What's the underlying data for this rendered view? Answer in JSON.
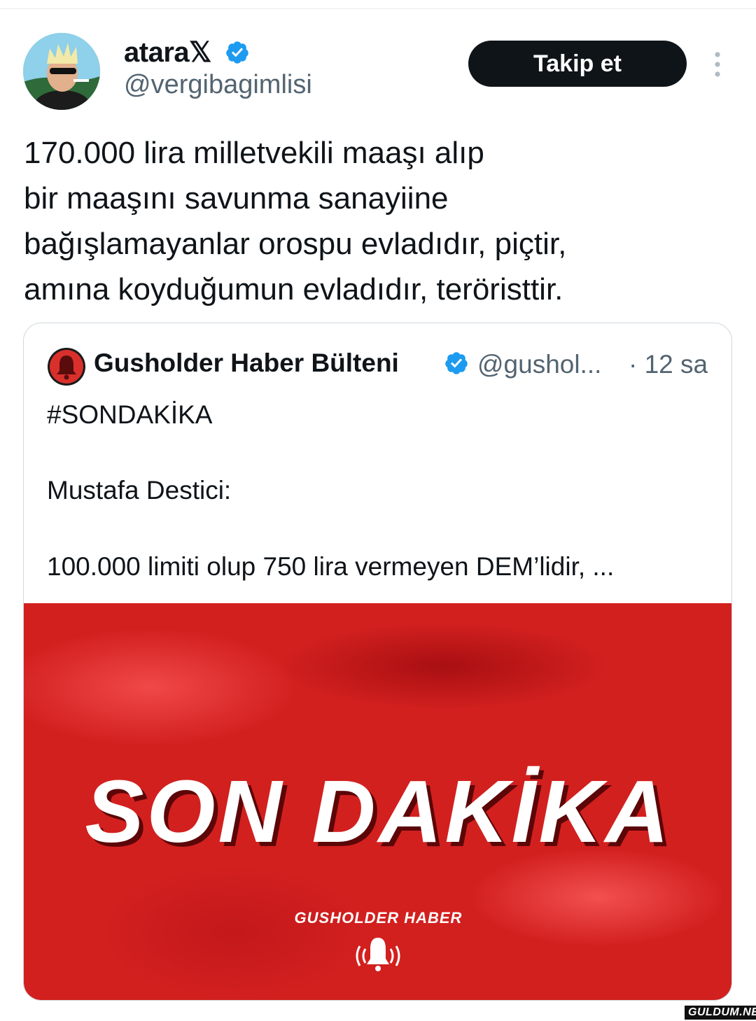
{
  "tweet": {
    "author_name": "atara𝕏",
    "author_handle": "@vergibagimlisi",
    "follow_label": "Takip et",
    "text_lines": [
      "170.000 lira milletvekili maaşı alıp",
      "bir maaşını savunma sanayiine",
      "bağışlamayanlar orospu evladıdır, piçtir,",
      "amına koyduğumun evladıdır, teröristtir."
    ]
  },
  "quote": {
    "author_name": "Gusholder Haber Bülteni",
    "author_handle": "@gushol...",
    "time": "· 12 sa",
    "text_lines": [
      "#SONDAKİKA",
      "Mustafa Destici:",
      "100.000 limiti olup 750 lira vermeyen DEM’lidir, ..."
    ],
    "media": {
      "title": "SON DAKİKA",
      "brand": "GUSHOLDER HABER"
    }
  },
  "watermark": "GULDUM.NET",
  "colors": {
    "accent_verified": "#1d9bf0",
    "follow_bg": "#0f1419",
    "media_red": "#d2201f",
    "secondary_text": "#536471"
  },
  "icons": [
    "verified-icon",
    "more-icon",
    "bell-icon"
  ]
}
